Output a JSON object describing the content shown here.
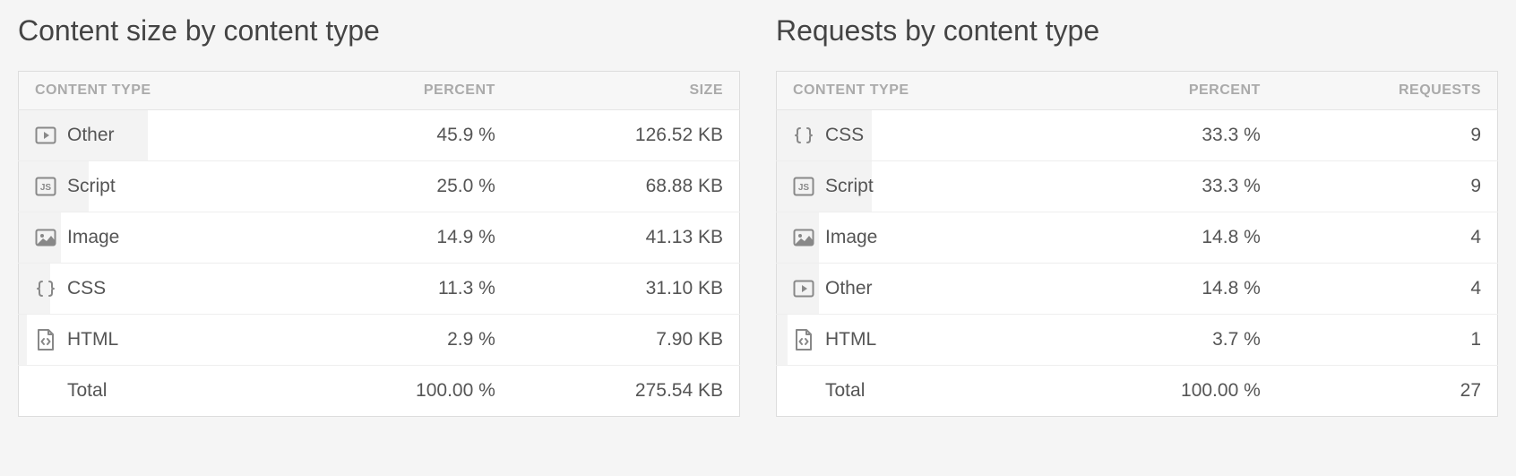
{
  "left": {
    "title": "Content size by content type",
    "columns": {
      "type": "CONTENT TYPE",
      "percent": "PERCENT",
      "value": "SIZE"
    },
    "rows": [
      {
        "icon": "play-icon",
        "type": "Other",
        "percent": "45.9 %",
        "value": "126.52 KB",
        "bar_pct": 45.9
      },
      {
        "icon": "js-icon",
        "type": "Script",
        "percent": "25.0 %",
        "value": "68.88 KB",
        "bar_pct": 25.0
      },
      {
        "icon": "image-icon",
        "type": "Image",
        "percent": "14.9 %",
        "value": "41.13 KB",
        "bar_pct": 14.9
      },
      {
        "icon": "braces-icon",
        "type": "CSS",
        "percent": "11.3 %",
        "value": "31.10 KB",
        "bar_pct": 11.3
      },
      {
        "icon": "code-icon",
        "type": "HTML",
        "percent": "2.9 %",
        "value": "7.90 KB",
        "bar_pct": 2.9
      }
    ],
    "total": {
      "type": "Total",
      "percent": "100.00 %",
      "value": "275.54 KB"
    }
  },
  "right": {
    "title": "Requests by content type",
    "columns": {
      "type": "CONTENT TYPE",
      "percent": "PERCENT",
      "value": "REQUESTS"
    },
    "rows": [
      {
        "icon": "braces-icon",
        "type": "CSS",
        "percent": "33.3 %",
        "value": "9",
        "bar_pct": 33.3
      },
      {
        "icon": "js-icon",
        "type": "Script",
        "percent": "33.3 %",
        "value": "9",
        "bar_pct": 33.3
      },
      {
        "icon": "image-icon",
        "type": "Image",
        "percent": "14.8 %",
        "value": "4",
        "bar_pct": 14.8
      },
      {
        "icon": "play-icon",
        "type": "Other",
        "percent": "14.8 %",
        "value": "4",
        "bar_pct": 14.8
      },
      {
        "icon": "code-icon",
        "type": "HTML",
        "percent": "3.7 %",
        "value": "1",
        "bar_pct": 3.7
      }
    ],
    "total": {
      "type": "Total",
      "percent": "100.00 %",
      "value": "27"
    }
  },
  "chart_data": [
    {
      "type": "table",
      "title": "Content size by content type",
      "columns": [
        "Content Type",
        "Percent",
        "Size (KB)"
      ],
      "rows": [
        [
          "Other",
          45.9,
          126.52
        ],
        [
          "Script",
          25.0,
          68.88
        ],
        [
          "Image",
          14.9,
          41.13
        ],
        [
          "CSS",
          11.3,
          31.1
        ],
        [
          "HTML",
          2.9,
          7.9
        ]
      ],
      "total": [
        "Total",
        100.0,
        275.54
      ]
    },
    {
      "type": "table",
      "title": "Requests by content type",
      "columns": [
        "Content Type",
        "Percent",
        "Requests"
      ],
      "rows": [
        [
          "CSS",
          33.3,
          9
        ],
        [
          "Script",
          33.3,
          9
        ],
        [
          "Image",
          14.8,
          4
        ],
        [
          "Other",
          14.8,
          4
        ],
        [
          "HTML",
          3.7,
          1
        ]
      ],
      "total": [
        "Total",
        100.0,
        27
      ]
    }
  ]
}
